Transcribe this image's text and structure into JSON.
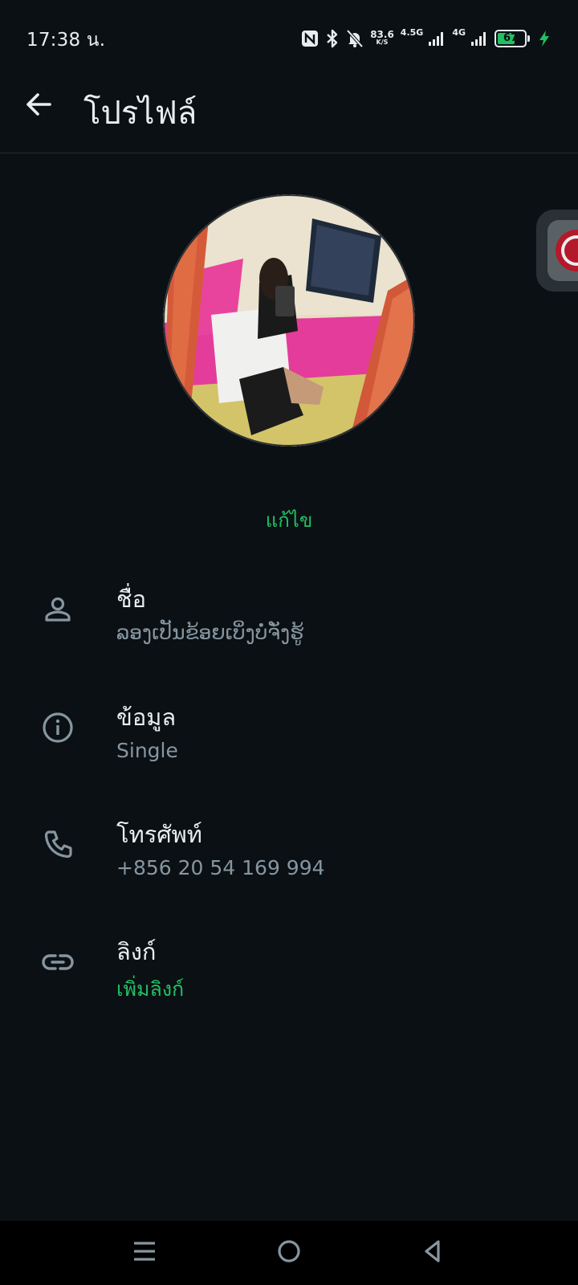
{
  "status_bar": {
    "time": "17:38 น.",
    "net_speed_value": "83.6",
    "net_speed_unit": "K/S",
    "signal1_label": "4.5G",
    "signal2_label": "4G",
    "battery_level": "67",
    "icons": [
      "nfc-icon",
      "bluetooth-icon",
      "bell-off-icon",
      "signal-icon",
      "battery-icon",
      "charging-icon"
    ]
  },
  "header": {
    "title": "โปรไฟล์"
  },
  "profile": {
    "edit_label": "แก้ไข"
  },
  "rows": [
    {
      "icon": "person-icon",
      "label": "ชื่อ",
      "value": "ລອງເປັນຂ້ອຍເບິ່ງບໍ່ຈັ່ງຮູ້"
    },
    {
      "icon": "info-icon",
      "label": "ข้อมูล",
      "value": "Single"
    },
    {
      "icon": "phone-icon",
      "label": "โทรศัพท์",
      "value": "+856 20 54 169 994"
    },
    {
      "icon": "link-icon",
      "label": "ลิงก์",
      "value": "เพิ่มลิงก์"
    }
  ],
  "colors": {
    "background": "#0b1014",
    "accent": "#21c063",
    "primary_text": "#e9edef",
    "secondary_text": "#8696a0"
  }
}
